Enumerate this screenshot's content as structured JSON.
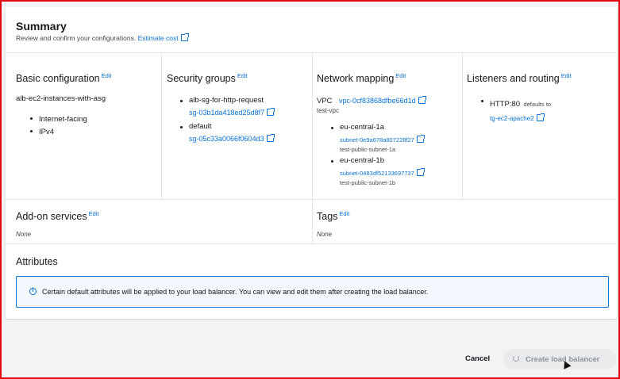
{
  "summary": {
    "title": "Summary",
    "subtitle": "Review and confirm your configurations.",
    "estimate_cost": "Estimate cost"
  },
  "basic": {
    "title": "Basic configuration",
    "edit": "Edit",
    "name": "alb-ec2-instances-with-asg",
    "items": [
      "Internet-facing",
      "IPv4"
    ]
  },
  "security": {
    "title": "Security groups",
    "edit": "Edit",
    "groups": [
      {
        "name": "alb-sg-for-http-request",
        "id": "sg-03b1da418ed25d8f7"
      },
      {
        "name": "default",
        "id": "sg-05c33a0066f0604d3"
      }
    ]
  },
  "network": {
    "title": "Network mapping",
    "edit": "Edit",
    "vpc_label": "VPC",
    "vpc_id": "vpc-0cf83868dfbe66d1d",
    "vpc_name": "test-vpc",
    "zones": [
      {
        "az": "eu-central-1a",
        "subnet_id": "subnet-0e9a678a807228f27",
        "subnet_name": "test-public-subnet-1a"
      },
      {
        "az": "eu-central-1b",
        "subnet_id": "subnet-0483df52133697737",
        "subnet_name": "test-public-subnet-1b"
      }
    ]
  },
  "listeners": {
    "title": "Listeners and routing",
    "edit": "Edit",
    "listener": "HTTP:80",
    "defaults_to": "defaults to",
    "target": "tg-ec2-apache2"
  },
  "addons": {
    "title": "Add-on services",
    "edit": "Edit",
    "value": "None"
  },
  "tags": {
    "title": "Tags",
    "edit": "Edit",
    "value": "None"
  },
  "attributes": {
    "title": "Attributes",
    "info": "Certain default attributes will be applied to your load balancer. You can view and edit them after creating the load balancer."
  },
  "footer": {
    "cancel": "Cancel",
    "create": "Create load balancer"
  },
  "colors": {
    "link": "#0972d3",
    "frame": "#e3050f",
    "info_bg": "#f2f8fd"
  },
  "icons": {
    "external": "external-link-icon",
    "info": "info-icon",
    "spinner": "spinner-icon"
  }
}
